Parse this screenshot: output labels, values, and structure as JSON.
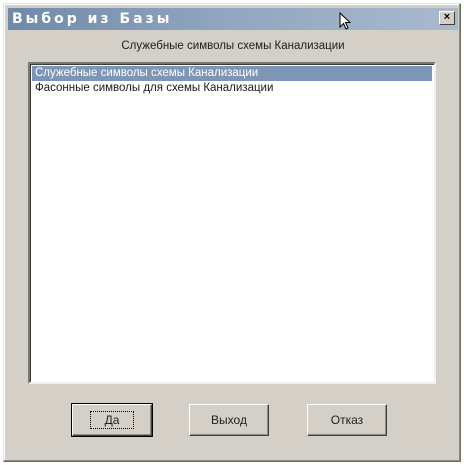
{
  "window": {
    "title": "Выбор из Базы",
    "caption": "Служебные символы схемы Канализации"
  },
  "titlebar": {
    "close_label": "×"
  },
  "list": {
    "items": [
      {
        "label": "Служебные символы схемы Канализации",
        "selected": true
      },
      {
        "label": "Фасонные символы для схемы Канализации",
        "selected": false
      }
    ]
  },
  "buttons": {
    "ok_label": "Да",
    "exit_label": "Выход",
    "cancel_label": "Отказ"
  },
  "colors": {
    "selection": "#7e96b6",
    "titlebar_start": "#6f8aa9",
    "titlebar_end": "#a9bacf",
    "face": "#d4d0c8"
  },
  "icons": {
    "cursor": "arrow-cursor-icon",
    "close": "close-icon"
  }
}
